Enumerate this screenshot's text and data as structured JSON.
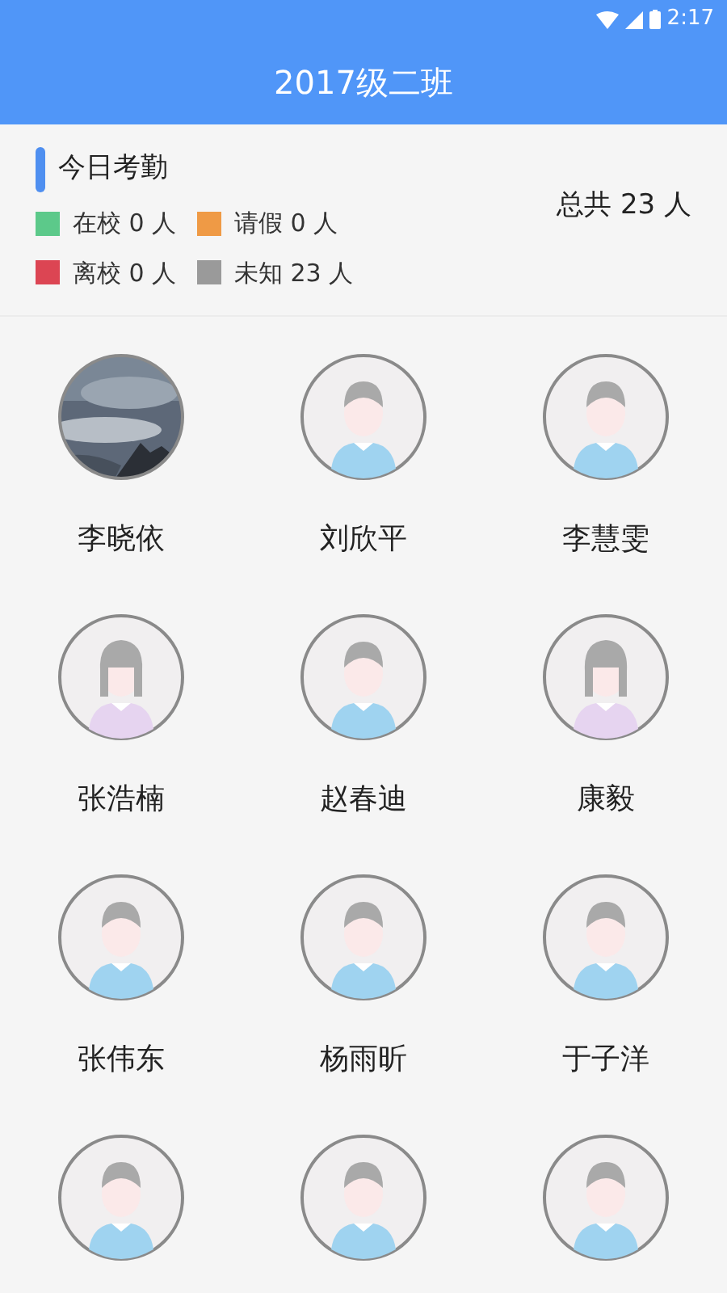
{
  "status_bar": {
    "time": "2:17"
  },
  "header": {
    "title": "2017级二班"
  },
  "attendance": {
    "title": "今日考勤",
    "legend": [
      {
        "label": "在校 0 人",
        "color": "#5cc98a"
      },
      {
        "label": "请假 0 人",
        "color": "#ef9a45"
      },
      {
        "label": "离校 0 人",
        "color": "#dc4553"
      },
      {
        "label": "未知 23 人",
        "color": "#9a9a9a"
      }
    ],
    "total": "总共 23 人"
  },
  "students": [
    {
      "name": "李晓依",
      "kind": "picture"
    },
    {
      "name": "刘欣平",
      "kind": "boy"
    },
    {
      "name": "李慧雯",
      "kind": "boy"
    },
    {
      "name": "张浩楠",
      "kind": "girl"
    },
    {
      "name": "赵春迪",
      "kind": "boy"
    },
    {
      "name": "康毅",
      "kind": "girl"
    },
    {
      "name": "张伟东",
      "kind": "boy"
    },
    {
      "name": "杨雨昕",
      "kind": "boy"
    },
    {
      "name": "于子洋",
      "kind": "boy"
    },
    {
      "kind": "boy"
    },
    {
      "kind": "boy"
    },
    {
      "kind": "boy"
    }
  ]
}
